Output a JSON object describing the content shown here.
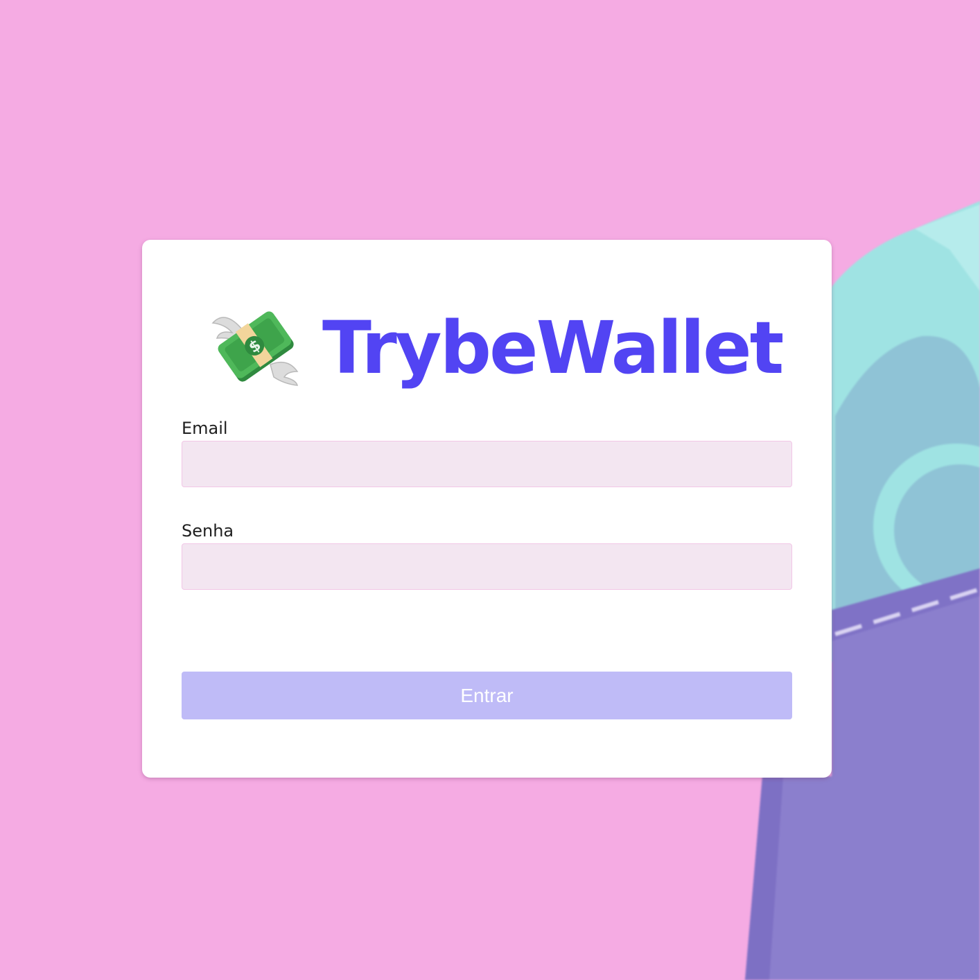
{
  "brand": {
    "title": "TrybeWallet",
    "logo_icon": "money-with-wings-icon"
  },
  "form": {
    "email_label": "Email",
    "email_value": "",
    "password_label": "Senha",
    "password_value": "",
    "submit_label": "Entrar",
    "submit_disabled": true
  },
  "background": {
    "illustration": "wallet-illustration",
    "page_color": "#f5abe3",
    "wallet_color": "#8b7fcd",
    "card_color": "#9fe3e3"
  },
  "colors": {
    "accent": "#5244f3",
    "button_disabled": "#bfbbf7",
    "input_bg": "#f3e6f1",
    "input_border": "#f1c6e6"
  }
}
